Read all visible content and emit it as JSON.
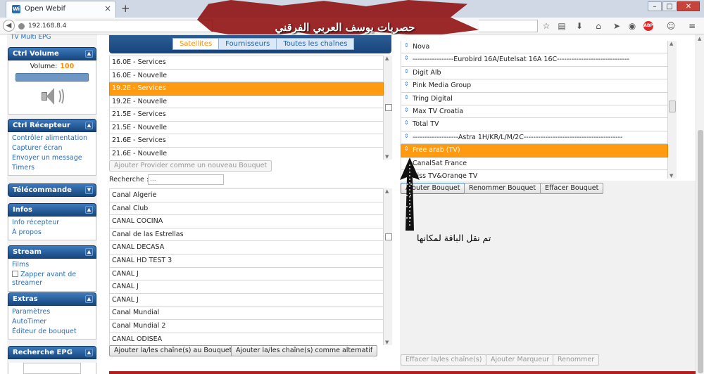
{
  "browser": {
    "tab_title": "Open Webif",
    "tab_favicon": "Wi",
    "url": "192.168.8.4"
  },
  "banner": {
    "text": "حصريات يوسف العربي الفرقني"
  },
  "sidebar": {
    "fragment": "TV Multi EPG",
    "ctrl_volume": {
      "title": "Ctrl Volume",
      "volume_label": "Volume:",
      "volume_value": "100",
      "volume_level": 1.0
    },
    "ctrl_recepteur": {
      "title": "Ctrl Récepteur",
      "items": [
        "Contrôler alimentation",
        "Capturer écran",
        "Envoyer un message",
        "Timers"
      ]
    },
    "telecommande": {
      "title": "Télécommande"
    },
    "infos": {
      "title": "Infos",
      "items": [
        "Info récepteur",
        "À propos"
      ]
    },
    "stream": {
      "title": "Stream",
      "items": [
        "Films"
      ],
      "zapper_label": "Zapper avant de streamer"
    },
    "extras": {
      "title": "Extras",
      "items": [
        "Paramètres",
        "AutoTimer",
        "Éditeur de bouquet"
      ]
    },
    "recherche_epg": {
      "title": "Recherche EPG"
    }
  },
  "providers": {
    "tabs": [
      "Satellites",
      "Fournisseurs",
      "Toutes les chaînes"
    ],
    "active_tab": 0,
    "items": [
      "16.0E - Services",
      "16.0E - Nouvelle",
      "19.2E - Services",
      "19.2E - Nouvelle",
      "21.5E - Services",
      "21.5E - Nouvelle",
      "21.6E - Services",
      "21.6E - Nouvelle"
    ],
    "selected": 2,
    "add_provider_button": "Ajouter Provider comme un nouveau Bouquet"
  },
  "search": {
    "label": "Recherche :",
    "placeholder": "..."
  },
  "channels": {
    "items": [
      "Canal Algerie",
      "Canal Club",
      "CANAL COCINA",
      "Canal de las Estrellas",
      "CANAL DECASA",
      "CANAL HD TEST 3",
      "CANAL J",
      "CANAL J",
      "CANAL J",
      "Canal Mundial",
      "Canal Mundial 2",
      "CANAL ODISEA"
    ],
    "add_button": "Ajouter la/les chaîne(s) au Bouquet",
    "add_alt_button": "Ajouter la/les chaîne(s) comme alternatif"
  },
  "bouquet": {
    "items": [
      "Nova",
      "-----------------Eurobird 16A/Eutelsat 16A 16C------------------------------",
      "Digit Alb",
      "Pink Media Group",
      "Tring Digital",
      "Max TV Croatia",
      "Total TV",
      "-------------------Astra 1H/KR/L/M/2C-----------------------------------------",
      "Free arab (TV)",
      "CanalSat France",
      "Biss TV&Orange TV"
    ],
    "selected": 8,
    "buttons": [
      "Ajouter Bouquet",
      "Renommer Bouquet",
      "Effacer Bouquet"
    ],
    "bottom_buttons": [
      "Effacer la/les chaîne(s)",
      "Ajouter Marqueur",
      "Renommer"
    ]
  },
  "annotation": {
    "text": "تم نقل الباقة لمكانها"
  }
}
